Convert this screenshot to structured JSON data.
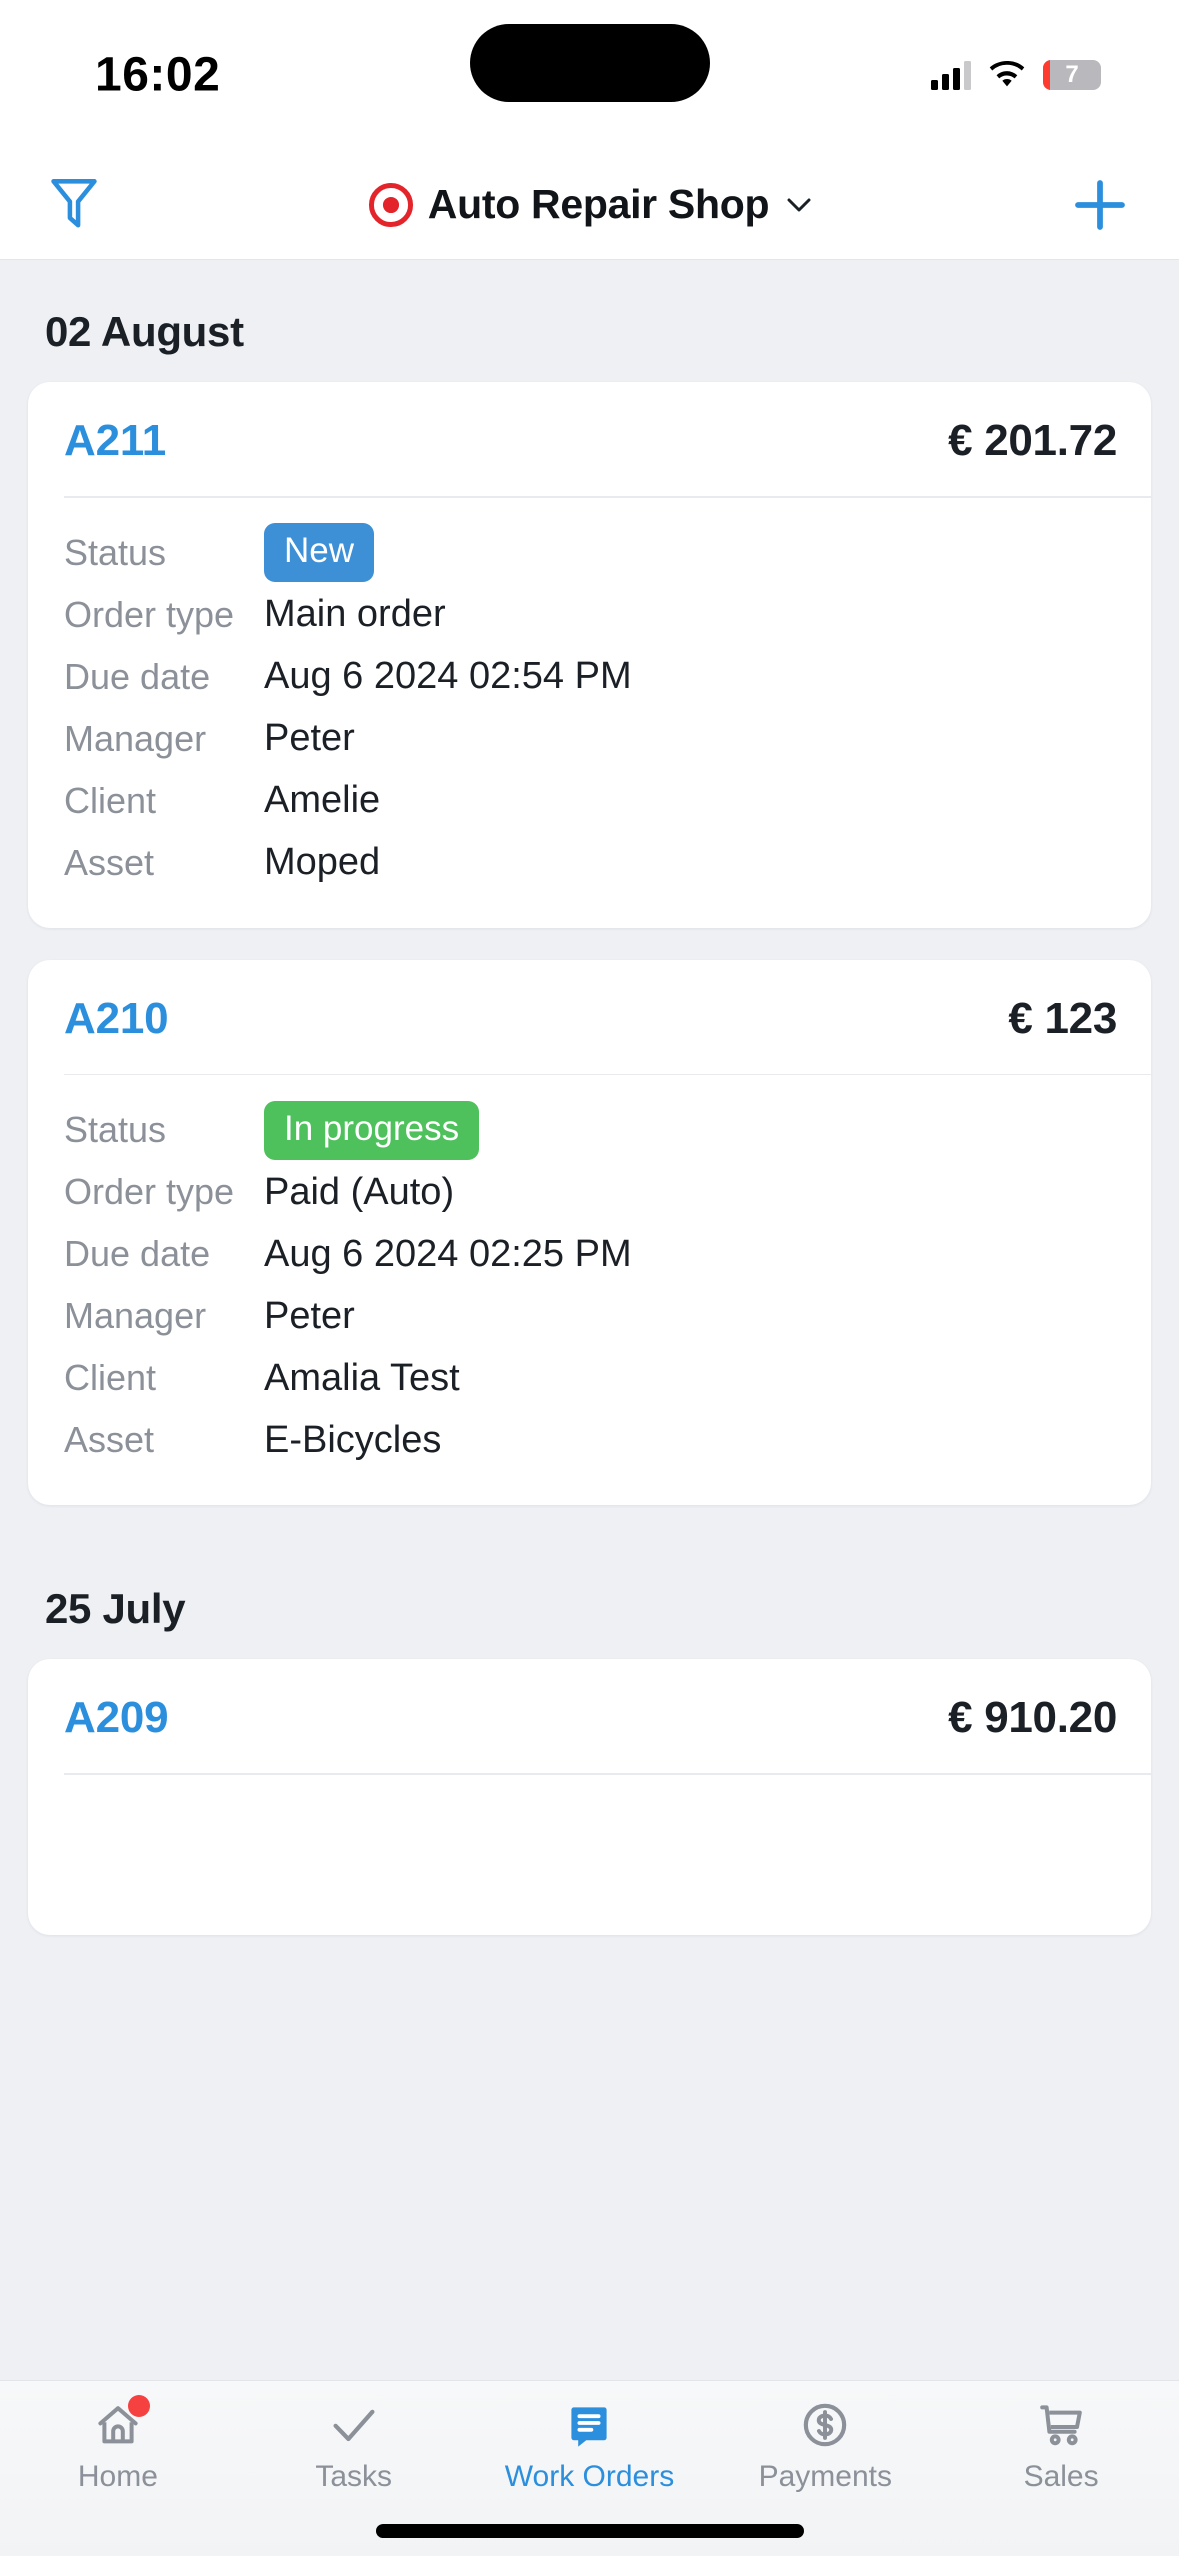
{
  "status_bar": {
    "time": "16:02",
    "battery_level": "7",
    "icons": [
      "cellular-signal-icon",
      "wifi-icon",
      "battery-icon"
    ]
  },
  "navbar": {
    "filter_icon": "filter-icon",
    "title": "Auto Repair Shop",
    "location_icon": "target-icon",
    "chevron_icon": "chevron-down-icon",
    "add_icon": "plus-icon"
  },
  "labels": {
    "status": "Status",
    "order_type": "Order type",
    "due_date": "Due date",
    "manager": "Manager",
    "client": "Client",
    "asset": "Asset"
  },
  "colors": {
    "accent": "#2b8fdd",
    "status_new": "#3d90d6",
    "status_in_progress": "#4ec15c",
    "background": "#eef0f4",
    "card": "#ffffff",
    "label_gray": "#8b9099",
    "badge_red": "#f5413f"
  },
  "sections": [
    {
      "date": "02 August",
      "orders": [
        {
          "id": "A211",
          "amount": "€ 201.72",
          "status": "New",
          "status_color": "blue",
          "order_type": "Main order",
          "due_date": "Aug 6 2024 02:54 PM",
          "manager": "Peter",
          "client": "Amelie",
          "asset": "Moped"
        },
        {
          "id": "A210",
          "amount": "€ 123",
          "status": "In progress",
          "status_color": "green",
          "order_type": "Paid (Auto)",
          "due_date": "Aug 6 2024 02:25 PM",
          "manager": "Peter",
          "client": "Amalia Test",
          "asset": "E-Bicycles"
        }
      ]
    },
    {
      "date": "25 July",
      "orders": [
        {
          "id": "A209",
          "amount": "€ 910.20"
        }
      ]
    }
  ],
  "tabbar": {
    "items": [
      {
        "label": "Home",
        "icon": "home-icon",
        "active": false,
        "badge": true
      },
      {
        "label": "Tasks",
        "icon": "check-icon",
        "active": false,
        "badge": false
      },
      {
        "label": "Work Orders",
        "icon": "work-orders-icon",
        "active": true,
        "badge": false
      },
      {
        "label": "Payments",
        "icon": "dollar-circle-icon",
        "active": false,
        "badge": false
      },
      {
        "label": "Sales",
        "icon": "shopping-cart-icon",
        "active": false,
        "badge": false
      }
    ]
  }
}
